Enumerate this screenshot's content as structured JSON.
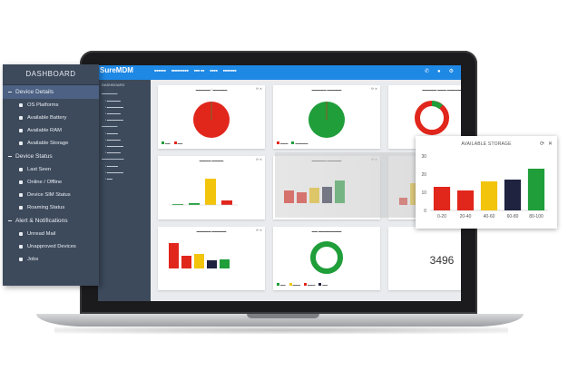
{
  "dashboard": {
    "title": "DASHBOARD",
    "sections": [
      {
        "label": "Device Details",
        "active": true,
        "items": [
          "OS Platforms",
          "Available Battery",
          "Available RAM",
          "Available Storage"
        ]
      },
      {
        "label": "Device Status",
        "active": false,
        "items": [
          "Last Seen",
          "Online / Offline",
          "Device SIM Status",
          "Roaming Status"
        ]
      },
      {
        "label": "Alert & Notifications",
        "active": false,
        "items": [
          "Unread Mail",
          "Unapproved Devices",
          "Jobs"
        ]
      }
    ]
  },
  "zoom_card": {
    "title": "AVAILABLE STORAGE",
    "refresh_icon": "refresh-icon",
    "close_icon": "close-icon"
  },
  "app": {
    "logo": "SureMDM",
    "sidebar_title": "DASHBOARD",
    "cards": {
      "total_count": "3496"
    }
  },
  "colors": {
    "red": "#e1261c",
    "green": "#1f9e3a",
    "yellow": "#f2c40c",
    "navy": "#1f2340",
    "nav_bg": "#3d4a5c",
    "nav_active": "#4c6183",
    "topbar": "#1e88e5"
  },
  "chart_data": [
    {
      "type": "bar",
      "title": "AVAILABLE STORAGE",
      "categories": [
        "0-20",
        "20-40",
        "40-60",
        "60-80",
        "80-100"
      ],
      "values": [
        13,
        11,
        16,
        17,
        23
      ],
      "colors": [
        "#e1261c",
        "#e1261c",
        "#f2c40c",
        "#1f2340",
        "#1f9e3a"
      ],
      "xlabel": "",
      "ylabel": "",
      "yticks": [
        0,
        10,
        20,
        30
      ],
      "ylim": [
        0,
        30
      ],
      "grid": false
    }
  ]
}
